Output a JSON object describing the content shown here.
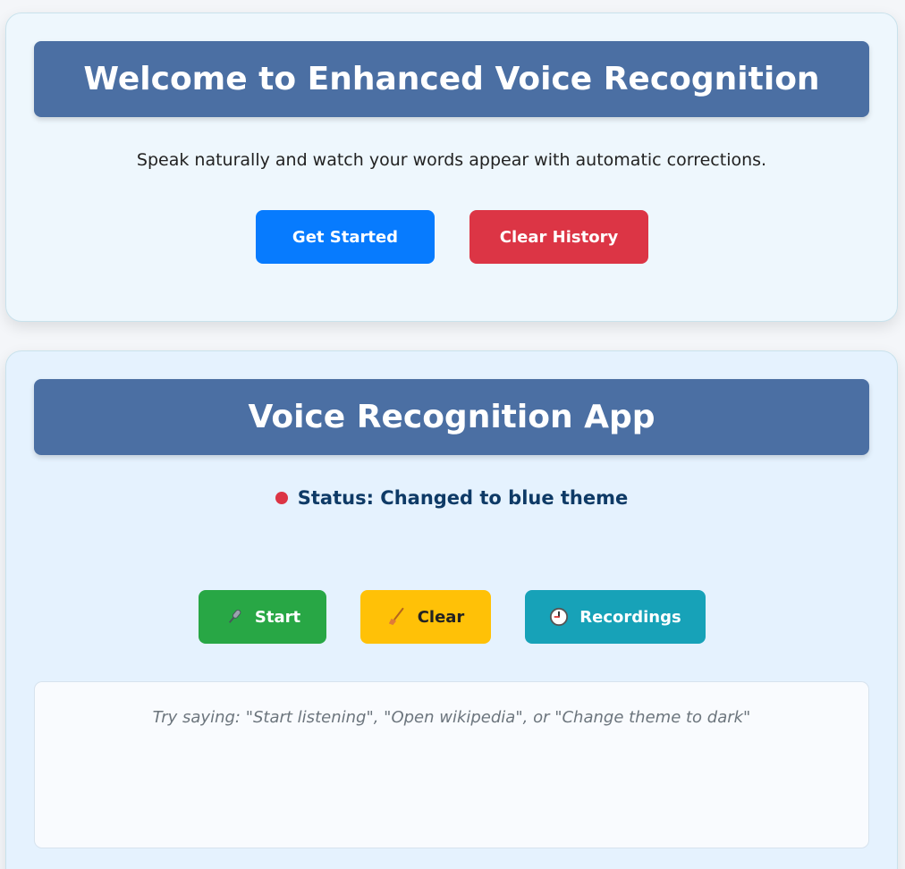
{
  "welcome": {
    "title": "Welcome to Enhanced Voice Recognition",
    "subtitle": "Speak naturally and watch your words appear with automatic corrections.",
    "get_started_label": "Get Started",
    "clear_history_label": "Clear History"
  },
  "app": {
    "title": "Voice Recognition App",
    "status_text": "Status: Changed to blue theme",
    "status_color": "#dc3545",
    "buttons": {
      "start": {
        "label": "Start",
        "icon": "microphone-icon"
      },
      "clear": {
        "label": "Clear",
        "icon": "broom-icon"
      },
      "recordings": {
        "label": "Recordings",
        "icon": "clock-icon"
      }
    },
    "transcript_placeholder": "Try saying: \"Start listening\", \"Open wikipedia\", or \"Change theme to dark\""
  },
  "colors": {
    "banner": "#4b6fa3",
    "primary": "#077bfe",
    "danger": "#dc3545",
    "success": "#28a745",
    "warning": "#ffc107",
    "info": "#17a2b8"
  }
}
